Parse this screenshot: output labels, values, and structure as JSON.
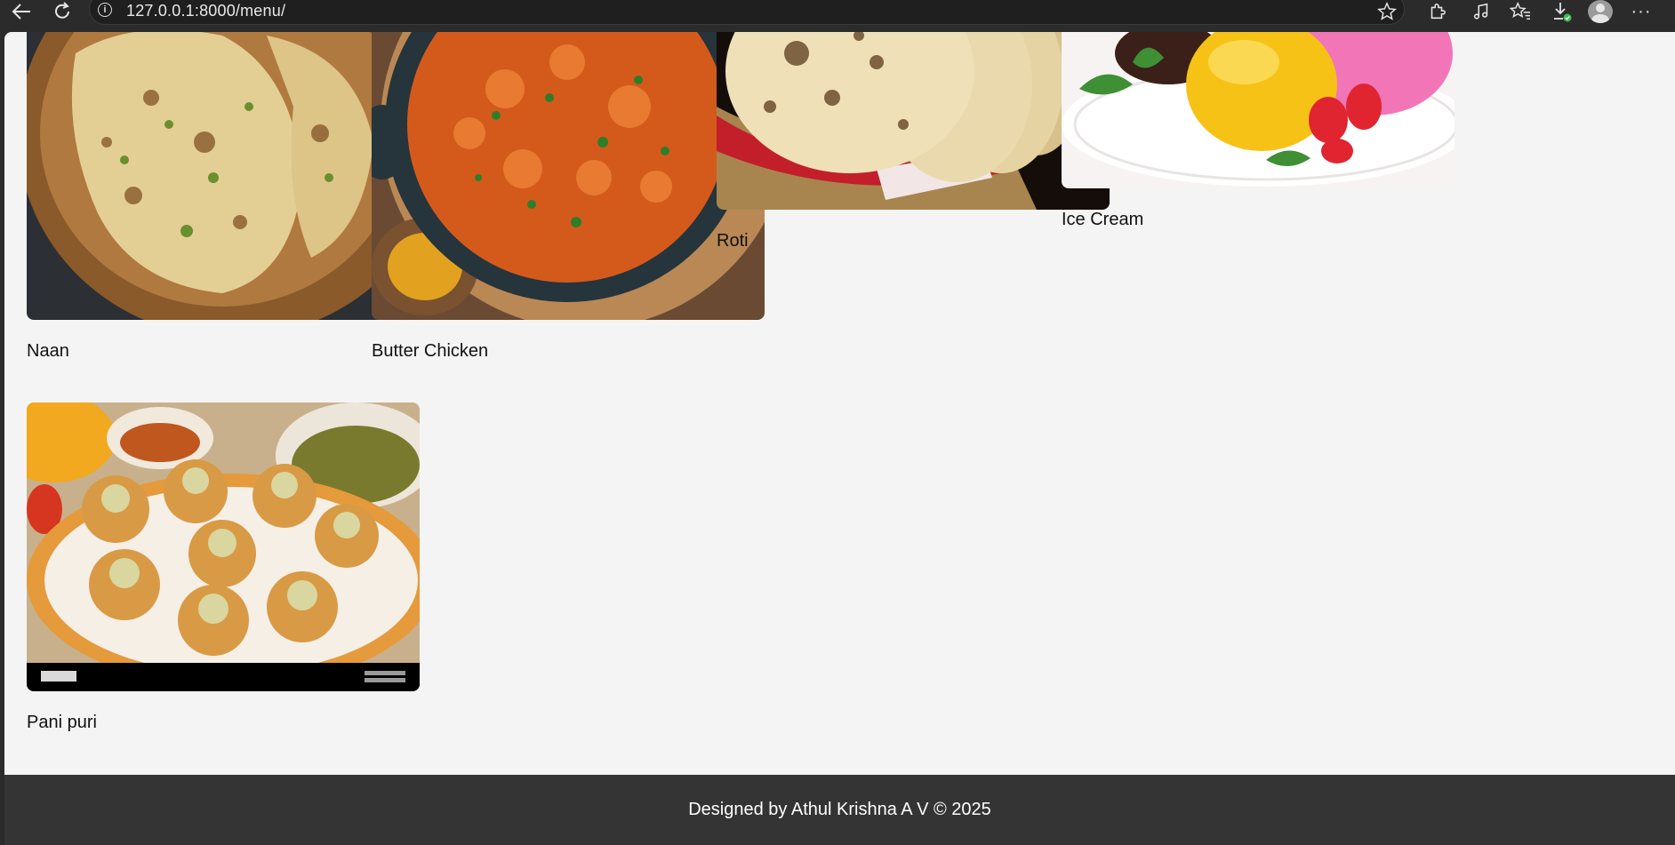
{
  "browser": {
    "url": "127.0.0.1:8000/menu/",
    "icons": [
      "back-icon",
      "refresh-icon",
      "site-info-icon",
      "favorite-star-icon",
      "extensions-icon",
      "media-icon",
      "favorites-icon",
      "downloads-icon",
      "profile-avatar",
      "more-icon"
    ]
  },
  "menu": {
    "items": [
      {
        "label": "Naan"
      },
      {
        "label": "Butter Chicken"
      },
      {
        "label": "Roti"
      },
      {
        "label": "Ice Cream"
      },
      {
        "label": "Pani puri"
      }
    ]
  },
  "footer": {
    "text": "Designed by Athul Krishna A V © 2025"
  }
}
